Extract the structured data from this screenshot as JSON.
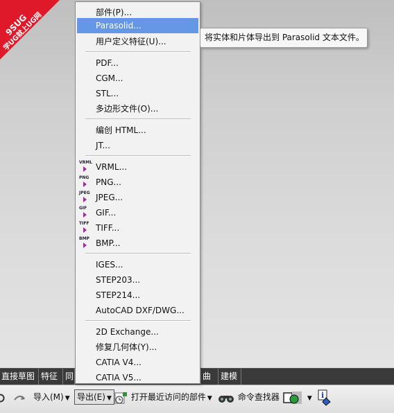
{
  "watermark": {
    "line1": "9SUG",
    "line2": "学UG就上UG网"
  },
  "menu": {
    "items": [
      {
        "id": "part",
        "label": "部件(P)..."
      },
      {
        "id": "parasolid",
        "label": "Parasolid...",
        "highlighted": true
      },
      {
        "id": "udf",
        "label": "用户定义特征(U)..."
      },
      {
        "id": "pdf",
        "label": "PDF..."
      },
      {
        "id": "cgm",
        "label": "CGM..."
      },
      {
        "id": "stl",
        "label": "STL..."
      },
      {
        "id": "polygon",
        "label": "多边形文件(O)..."
      },
      {
        "id": "html",
        "label": "编创 HTML..."
      },
      {
        "id": "jt",
        "label": "JT..."
      },
      {
        "id": "vrml",
        "label": "VRML...",
        "format": "VRML"
      },
      {
        "id": "png",
        "label": "PNG...",
        "format": "PNG"
      },
      {
        "id": "jpeg",
        "label": "JPEG...",
        "format": "JPEG"
      },
      {
        "id": "gif",
        "label": "GIF...",
        "format": "GIF"
      },
      {
        "id": "tiff",
        "label": "TIFF...",
        "format": "TIFF"
      },
      {
        "id": "bmp",
        "label": "BMP...",
        "format": "BMP"
      },
      {
        "id": "iges",
        "label": "IGES..."
      },
      {
        "id": "step203",
        "label": "STEP203..."
      },
      {
        "id": "step214",
        "label": "STEP214..."
      },
      {
        "id": "dxf",
        "label": "AutoCAD DXF/DWG..."
      },
      {
        "id": "exchange2d",
        "label": "2D Exchange..."
      },
      {
        "id": "repair",
        "label": "修复几何体(Y)..."
      },
      {
        "id": "catia4",
        "label": "CATIA V4..."
      },
      {
        "id": "catia5",
        "label": "CATIA V5..."
      }
    ]
  },
  "tooltip": {
    "text": "将实体和片体导出到 Parasolid 文本文件。"
  },
  "command_tabs": [
    {
      "label": "直接草图"
    },
    {
      "label": "特征"
    },
    {
      "label": "同"
    },
    {
      "label": "曲面"
    },
    {
      "label": "建模"
    }
  ],
  "toolbar": {
    "import_label": "导入(M)",
    "export_label": "导出(E)",
    "open_recent_label": "打开最近访问的部件",
    "command_finder_label": "命令查找器"
  },
  "colors": {
    "highlight": "#6497e6",
    "command_bar": "#3a3a3a",
    "watermark": "#e0192a",
    "format_arrow": "#a52a9d"
  }
}
